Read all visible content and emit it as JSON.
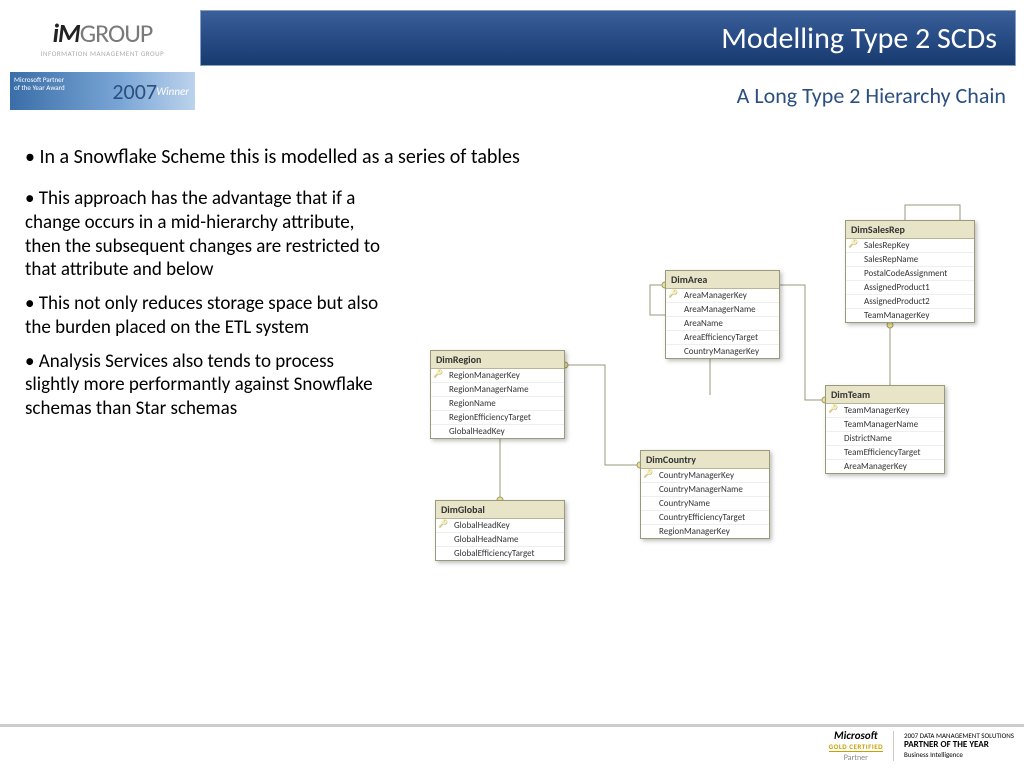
{
  "logo": {
    "brand_i": "iM",
    "brand_rest": "GROUP",
    "tagline": "INFORMATION MANAGEMENT GROUP"
  },
  "badge": {
    "line1": "Microsoft Partner",
    "line2": "of the Year Award",
    "year": "2007",
    "winner": "Winner"
  },
  "title": "Modelling Type 2 SCDs",
  "subtitle": "A Long Type 2 Hierarchy Chain",
  "intro": "In a Snowflake Scheme this is modelled as a series of tables",
  "bullets": [
    "This approach has the advantage that if a change occurs in a mid-hierarchy attribute, then the subsequent changes are restricted to that attribute and below",
    "This not only reduces storage space but also the burden placed on the ETL system",
    "Analysis Services also tends to process slightly  more performantly against Snowflake schemas than Star schemas"
  ],
  "tables": {
    "region": {
      "name": "DimRegion",
      "cols": [
        "RegionManagerKey",
        "RegionManagerName",
        "RegionName",
        "RegionEfficiencyTarget",
        "GlobalHeadKey"
      ]
    },
    "global": {
      "name": "DimGlobal",
      "cols": [
        "GlobalHeadKey",
        "GlobalHeadName",
        "GlobalEfficiencyTarget"
      ]
    },
    "area": {
      "name": "DimArea",
      "cols": [
        "AreaManagerKey",
        "AreaManagerName",
        "AreaName",
        "AreaEfficiencyTarget",
        "CountryManagerKey"
      ]
    },
    "country": {
      "name": "DimCountry",
      "cols": [
        "CountryManagerKey",
        "CountryManagerName",
        "CountryName",
        "CountryEfficiencyTarget",
        "RegionManagerKey"
      ]
    },
    "salesrep": {
      "name": "DimSalesRep",
      "cols": [
        "SalesRepKey",
        "SalesRepName",
        "PostalCodeAssignment",
        "AssignedProduct1",
        "AssignedProduct2",
        "TeamManagerKey"
      ]
    },
    "team": {
      "name": "DimTeam",
      "cols": [
        "TeamManagerKey",
        "TeamManagerName",
        "DistrictName",
        "TeamEfficiencyTarget",
        "AreaManagerKey"
      ]
    }
  },
  "footer": {
    "ms": "Microsoft",
    "gold": "GOLD CERTIFIED",
    "partner": "Partner",
    "award_top": "2007 DATA MANAGEMENT SOLUTIONS",
    "award_main": "PARTNER OF THE YEAR",
    "award_sub": "Business Intelligence"
  }
}
